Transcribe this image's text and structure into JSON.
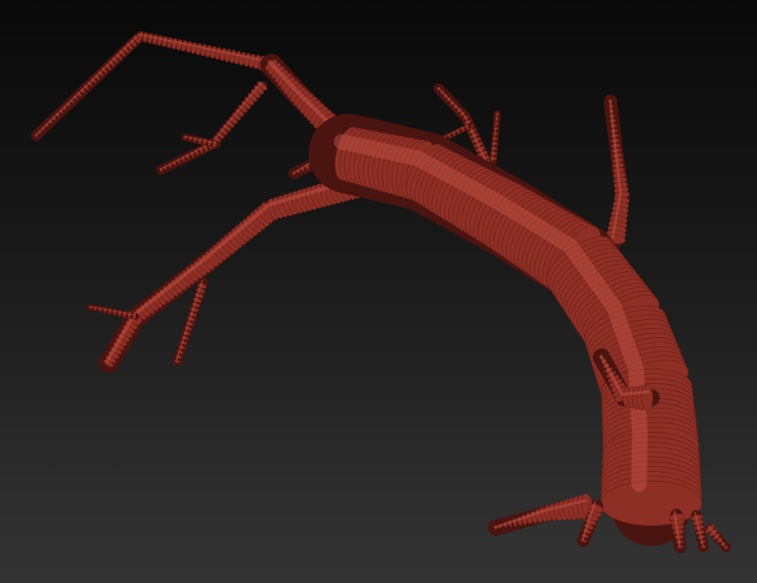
{
  "scene": {
    "subject": "tree-branch-sculpt",
    "colors": {
      "background_top": "#090909",
      "background_bottom": "#343434",
      "branch_base": "#8e2f25",
      "branch_highlight": "#c7584a",
      "branch_shadow": "#4a1410",
      "ring_line": "#6e211a"
    }
  }
}
